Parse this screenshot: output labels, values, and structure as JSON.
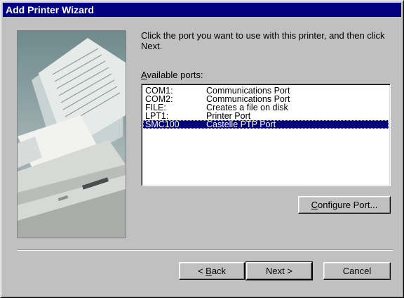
{
  "window": {
    "title": "Add Printer Wizard"
  },
  "instructions": "Click the port you want to use with this printer, and then click Next.",
  "ports_label_first": "A",
  "ports_label_rest": "vailable ports:",
  "ports": [
    {
      "name": "COM1:",
      "description": "Communications Port"
    },
    {
      "name": "COM2:",
      "description": "Communications Port"
    },
    {
      "name": "FILE:",
      "description": "Creates a file on disk"
    },
    {
      "name": "LPT1:",
      "description": "Printer Port"
    },
    {
      "name": "SMC100",
      "description": "Castelle  PTP  Port",
      "selected": true
    }
  ],
  "buttons": {
    "configure_first": "C",
    "configure_rest": "onfigure Port...",
    "back_pre": "< ",
    "back_first": "B",
    "back_rest": "ack",
    "next": "Next >",
    "cancel": "Cancel"
  },
  "colors": {
    "selection": "#000080",
    "titlebar": "#000080",
    "face": "#c0c0c0"
  },
  "illustration": "printer-with-paper-image"
}
